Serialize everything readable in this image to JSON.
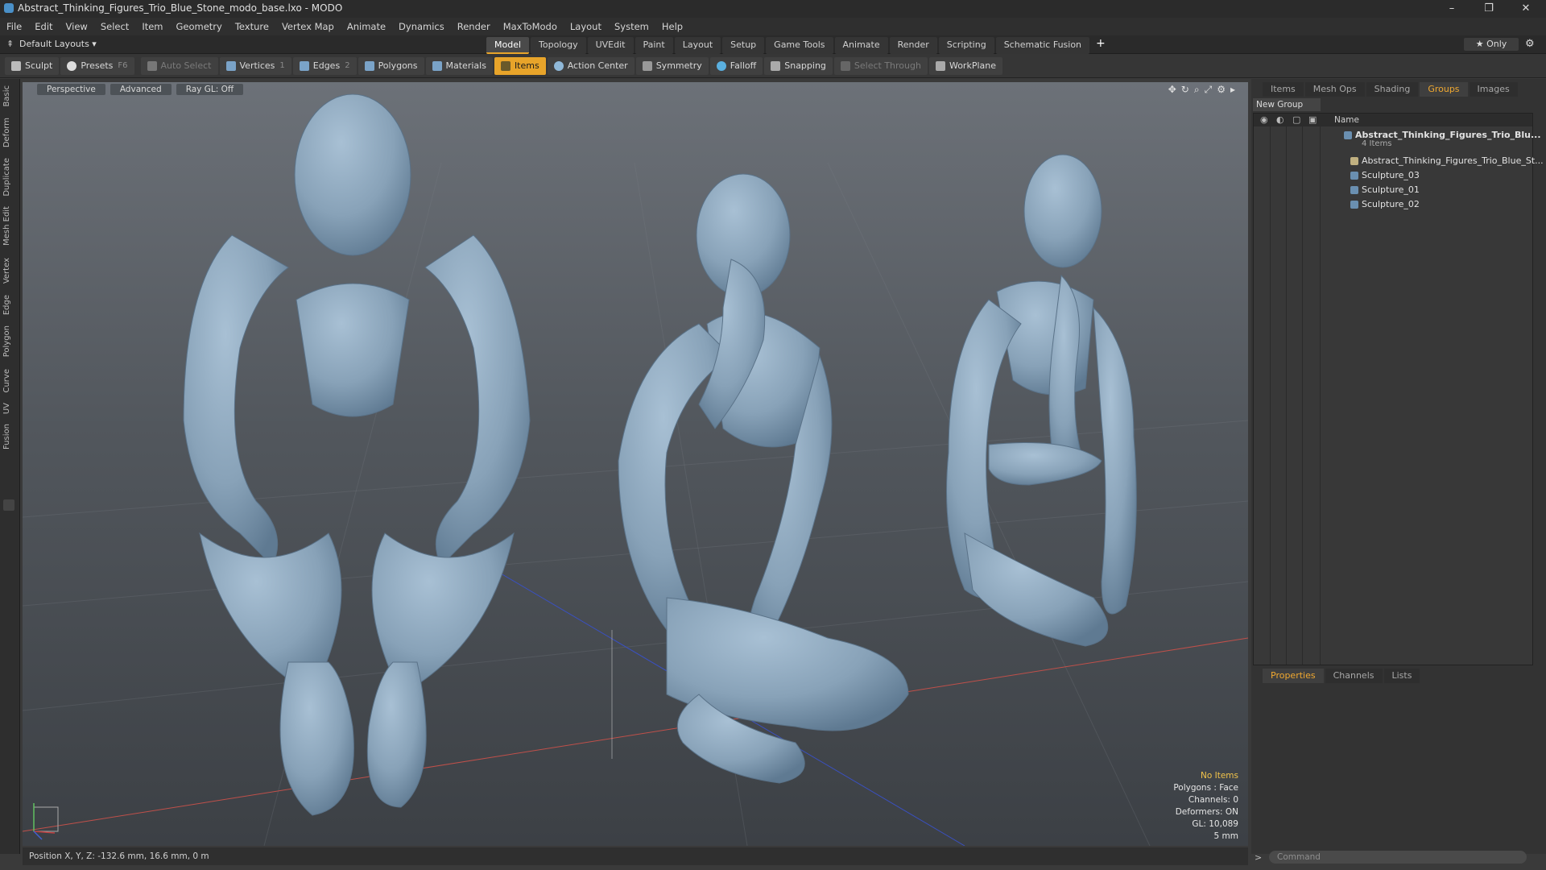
{
  "window": {
    "title": "Abstract_Thinking_Figures_Trio_Blue_Stone_modo_base.lxo - MODO"
  },
  "menu": [
    "File",
    "Edit",
    "View",
    "Select",
    "Item",
    "Geometry",
    "Texture",
    "Vertex Map",
    "Animate",
    "Dynamics",
    "Render",
    "MaxToModo",
    "Layout",
    "System",
    "Help"
  ],
  "layout": {
    "default_layouts": "Default Layouts ▾",
    "tabs": [
      "Model",
      "Topology",
      "UVEdit",
      "Paint",
      "Layout",
      "Setup",
      "Game Tools",
      "Animate",
      "Render",
      "Scripting",
      "Schematic Fusion"
    ],
    "active_tab": "Model",
    "add": "+",
    "only": "★ Only"
  },
  "toolbar": {
    "sculpt": "Sculpt",
    "presets": "Presets",
    "presets_key": "F6",
    "auto_select": "Auto Select",
    "vertices": "Vertices",
    "vertices_count": "1",
    "edges": "Edges",
    "edges_count": "2",
    "polygons": "Polygons",
    "materials": "Materials",
    "items": "Items",
    "action_center": "Action Center",
    "symmetry": "Symmetry",
    "falloff": "Falloff",
    "snapping": "Snapping",
    "select_through": "Select Through",
    "workplane": "WorkPlane"
  },
  "left_tabs": [
    "Basic",
    "Deform",
    "Duplicate",
    "Mesh Edit",
    "Vertex",
    "Edge",
    "Polygon",
    "Curve",
    "UV",
    "Fusion"
  ],
  "viewport": {
    "view": "Perspective",
    "mode": "Advanced",
    "raygl": "Ray GL: Off",
    "hud": {
      "items": "No Items",
      "polygons": "Polygons : Face",
      "channels": "Channels: 0",
      "deformers": "Deformers: ON",
      "gl": "GL: 10,089",
      "unit": "5 mm"
    }
  },
  "right_panel": {
    "tabs": [
      "Items",
      "Mesh Ops",
      "Shading",
      "Groups",
      "Images"
    ],
    "active_tab": "Groups",
    "new_group": "New Group",
    "name_col": "Name",
    "tree": [
      {
        "label": "Abstract_Thinking_Figures_Trio_Blu...",
        "sub": "4 Items"
      },
      {
        "label": "Abstract_Thinking_Figures_Trio_Blue_St..."
      },
      {
        "label": "Sculpture_03"
      },
      {
        "label": "Sculpture_01"
      },
      {
        "label": "Sculpture_02"
      }
    ],
    "prop_tabs": [
      "Properties",
      "Channels",
      "Lists"
    ],
    "prop_active": "Properties",
    "command_placeholder": "Command"
  },
  "status": {
    "position": "Position X, Y, Z:  -132.6 mm, 16.6 mm, 0 m"
  },
  "colors": {
    "accent": "#e8a42a",
    "stone": "#8aa4bc"
  }
}
